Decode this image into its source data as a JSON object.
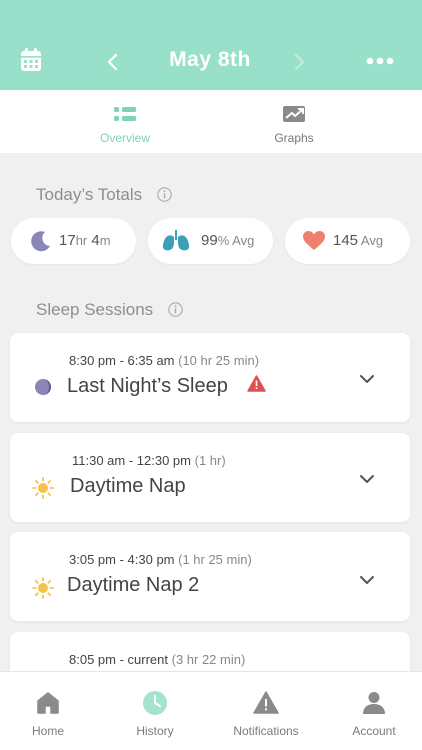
{
  "colors": {
    "accent": "#98e0c9",
    "accent_text": "#7fd3b6",
    "alert": "#e05050",
    "heart": "#ef8070",
    "lungs": "#3d9fb8",
    "moon": "#8b86b8",
    "sun": "#f5c24a"
  },
  "header": {
    "date": "May 8th",
    "calendar_icon": "calendar-icon",
    "prev_icon": "chevron-left-icon",
    "next_icon": "chevron-right-icon",
    "more_icon": "more-icon"
  },
  "tabs": [
    {
      "label": "Overview",
      "icon": "list-icon",
      "active": true
    },
    {
      "label": "Graphs",
      "icon": "graph-icon",
      "active": false
    }
  ],
  "totals": {
    "title": "Today’s Totals",
    "sleep": {
      "value": "17",
      "unit1": "hr",
      "value2": " 4",
      "unit2": "m"
    },
    "oxygen": {
      "value": "99",
      "unit": "% Avg"
    },
    "heart": {
      "value": "145",
      "unit": " Avg"
    }
  },
  "sessions": {
    "title": "Sleep Sessions",
    "items": [
      {
        "time": "8:30 pm - 6:35 am",
        "duration": " (10 hr 25 min)",
        "name": "Last Night’s Sleep",
        "kind": "moon",
        "alert": true
      },
      {
        "time": "11:30 am - 12:30 pm",
        "duration": " (1 hr)",
        "name": "Daytime Nap",
        "kind": "sun",
        "alert": false
      },
      {
        "time": "3:05 pm - 4:30 pm",
        "duration": " (1 hr 25 min)",
        "name": "Daytime Nap 2",
        "kind": "sun",
        "alert": false
      },
      {
        "time": "8:05 pm - current",
        "duration": " (3 hr 22 min)",
        "name": "",
        "kind": "",
        "alert": false
      }
    ]
  },
  "bottom_nav": [
    {
      "label": "Home",
      "icon": "home-icon",
      "active": false
    },
    {
      "label": "History",
      "icon": "clock-icon",
      "active": true
    },
    {
      "label": "Notifications",
      "icon": "alert-icon",
      "active": false
    },
    {
      "label": "Account",
      "icon": "person-icon",
      "active": false
    }
  ]
}
